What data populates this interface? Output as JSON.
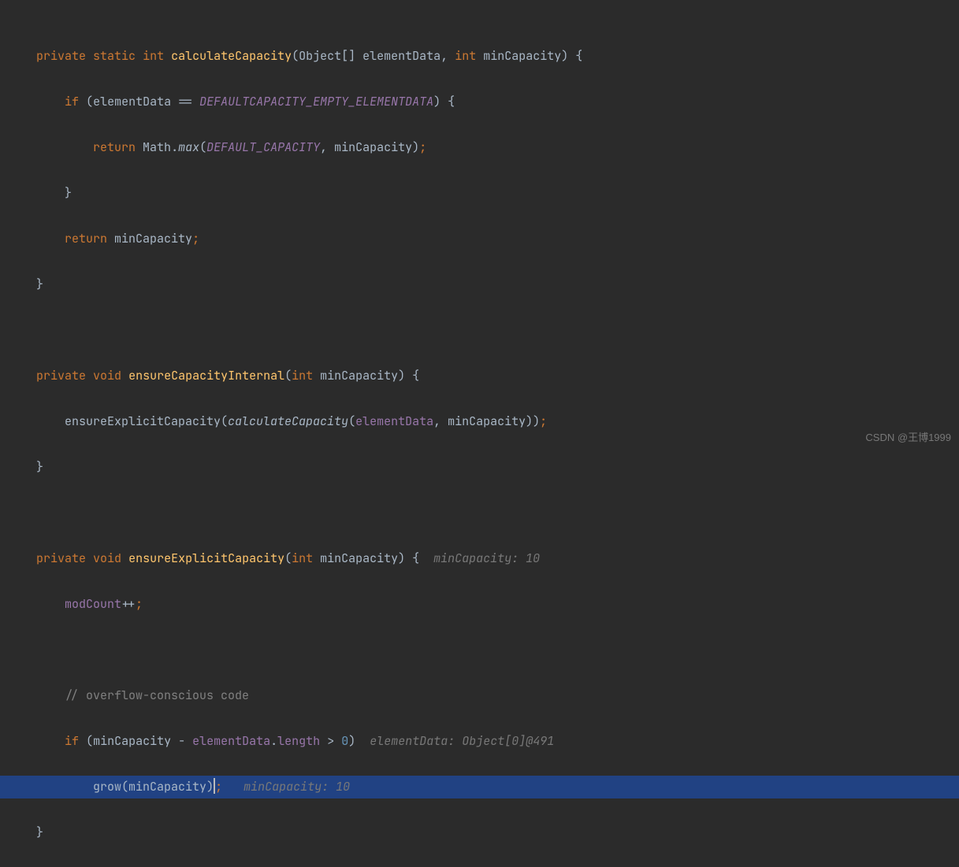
{
  "code": {
    "l1": {
      "kw1": "private",
      "kw2": "static",
      "kw3": "int",
      "method": "calculateCapacity",
      "p1type": "Object",
      "p1name": "elementData",
      "p2type": "int",
      "p2name": "minCapacity"
    },
    "l2": {
      "kw": "if",
      "var": "elementData",
      "constant": "DEFAULTCAPACITY_EMPTY_ELEMENTDATA"
    },
    "l3": {
      "kw": "return",
      "cls": "Math",
      "method": "max",
      "arg1": "DEFAULT_CAPACITY",
      "arg2": "minCapacity"
    },
    "l5": {
      "kw": "return",
      "var": "minCapacity"
    },
    "l8": {
      "kw1": "private",
      "kw2": "void",
      "method": "ensureCapacityInternal",
      "ptype": "int",
      "pname": "minCapacity"
    },
    "l9": {
      "call1": "ensureExplicitCapacity",
      "call2": "calculateCapacity",
      "arg1": "elementData",
      "arg2": "minCapacity"
    },
    "l12": {
      "kw1": "private",
      "kw2": "void",
      "method": "ensureExplicitCapacity",
      "ptype": "int",
      "pname": "minCapacity",
      "hint": "minCapacity: 10"
    },
    "l13": {
      "field": "modCount"
    },
    "l15": {
      "comment": "// overflow-conscious code"
    },
    "l16": {
      "kw": "if",
      "var1": "minCapacity",
      "var2": "elementData",
      "prop": "length",
      "num": "0",
      "hint": "elementData: Object[0]@491"
    },
    "l17": {
      "call": "grow",
      "arg": "minCapacity",
      "hint": "minCapacity: 10"
    }
  },
  "watermark": "CSDN @王博1999"
}
